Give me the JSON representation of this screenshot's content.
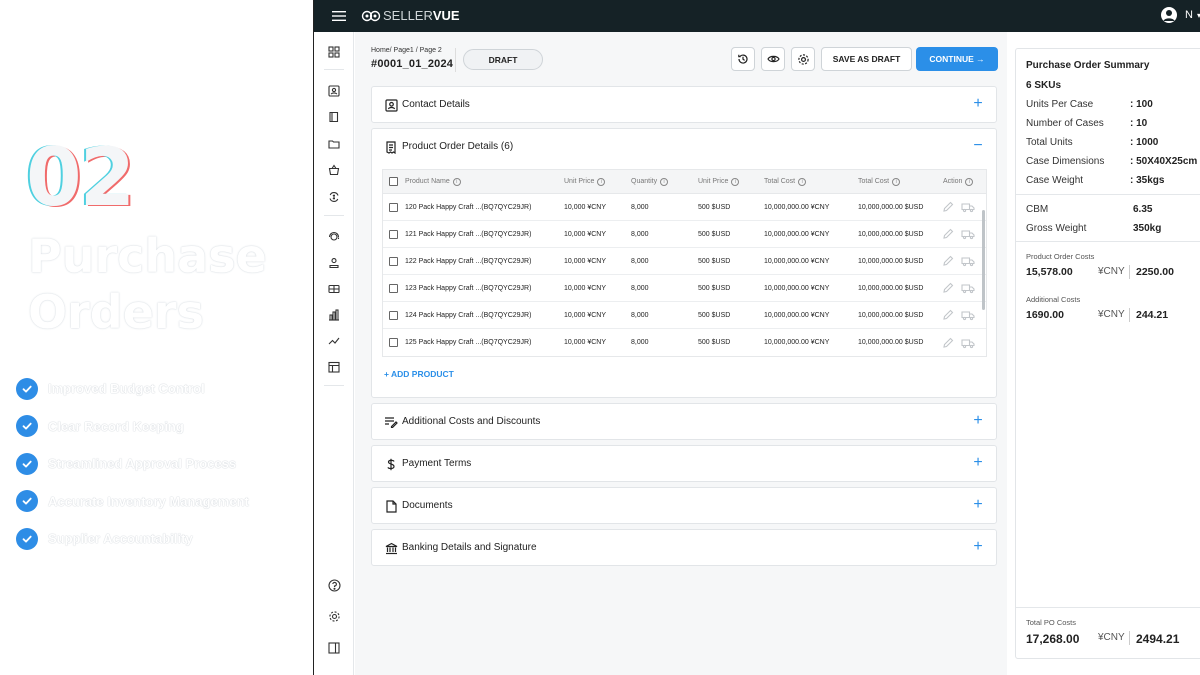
{
  "promo": {
    "number": "02",
    "title": "Purchase Orders",
    "features": [
      "Improved Budget Control",
      "Clear Record Keeping",
      "Streamlined Approval Process",
      "Accurate Inventory Management",
      "Supplier Accountability"
    ]
  },
  "app": {
    "logo_a": "SELLER",
    "logo_b": "VUE",
    "user_initial": "N"
  },
  "header": {
    "breadcrumb": "Home/ Page1 / Page 2",
    "po_id": "#0001_01_2024",
    "status": "DRAFT",
    "save_draft_label": "SAVE AS DRAFT",
    "continue_label": "CONTINUE →"
  },
  "sections": {
    "contact": "Contact Details",
    "product": "Product Order Details (6)",
    "additional": "Additional Costs and Discounts",
    "payment": "Payment Terms",
    "documents": "Documents",
    "banking": "Banking Details and Signature",
    "plus": "+",
    "minus": "−"
  },
  "table": {
    "headers": [
      "Product Name",
      "Unit Price",
      "Quantity",
      "Unit Price",
      "Total Cost",
      "Total Cost",
      "Action"
    ],
    "rows": [
      {
        "name": "120 Pack Happy Craft ...(BQ7QYC29JR)",
        "unit_cny": "10,000 ¥CNY",
        "qty": "8,000",
        "unit_usd": "500 $USD",
        "total_cny": "10,000,000.00 ¥CNY",
        "total_usd": "10,000,000.00 $USD"
      },
      {
        "name": "121 Pack Happy Craft ...(BQ7QYC29JR)",
        "unit_cny": "10,000 ¥CNY",
        "qty": "8,000",
        "unit_usd": "500 $USD",
        "total_cny": "10,000,000.00 ¥CNY",
        "total_usd": "10,000,000.00 $USD"
      },
      {
        "name": "122 Pack Happy Craft ...(BQ7QYC29JR)",
        "unit_cny": "10,000 ¥CNY",
        "qty": "8,000",
        "unit_usd": "500 $USD",
        "total_cny": "10,000,000.00 ¥CNY",
        "total_usd": "10,000,000.00 $USD"
      },
      {
        "name": "123 Pack Happy Craft ...(BQ7QYC29JR)",
        "unit_cny": "10,000 ¥CNY",
        "qty": "8,000",
        "unit_usd": "500 $USD",
        "total_cny": "10,000,000.00 ¥CNY",
        "total_usd": "10,000,000.00 $USD"
      },
      {
        "name": "124 Pack Happy Craft ...(BQ7QYC29JR)",
        "unit_cny": "10,000 ¥CNY",
        "qty": "8,000",
        "unit_usd": "500 $USD",
        "total_cny": "10,000,000.00 ¥CNY",
        "total_usd": "10,000,000.00 $USD"
      },
      {
        "name": "125 Pack Happy Craft ...(BQ7QYC29JR)",
        "unit_cny": "10,000 ¥CNY",
        "qty": "8,000",
        "unit_usd": "500 $USD",
        "total_cny": "10,000,000.00 ¥CNY",
        "total_usd": "10,000,000.00 $USD"
      }
    ],
    "add_product": "+ ADD PRODUCT"
  },
  "summary": {
    "title": "Purchase Order Summary",
    "skus": "6 SKUs",
    "rows": [
      {
        "label": "Units Per Case",
        "value": ": 100"
      },
      {
        "label": "Number of Cases",
        "value": ": 10"
      },
      {
        "label": "Total Units",
        "value": ": 1000"
      },
      {
        "label": "Case Dimensions",
        "value": ": 50X40X25cm"
      },
      {
        "label": "Case Weight",
        "value": ": 35kgs"
      }
    ],
    "rows2": [
      {
        "label": "CBM",
        "value": "6.35"
      },
      {
        "label": "Gross Weight",
        "value": "350kg"
      }
    ],
    "product_costs": {
      "label": "Product Order Costs",
      "a": "15,578.00",
      "cur": "¥CNY",
      "b": "2250.00"
    },
    "additional_costs": {
      "label": "Additional Costs",
      "a": "1690.00",
      "cur": "¥CNY",
      "b": "244.21"
    },
    "total_costs": {
      "label": "Total PO Costs",
      "a": "17,268.00",
      "cur": "¥CNY",
      "b": "2494.21"
    }
  },
  "colors": {
    "accent": "#2b8fe8",
    "topbar": "#152226"
  }
}
